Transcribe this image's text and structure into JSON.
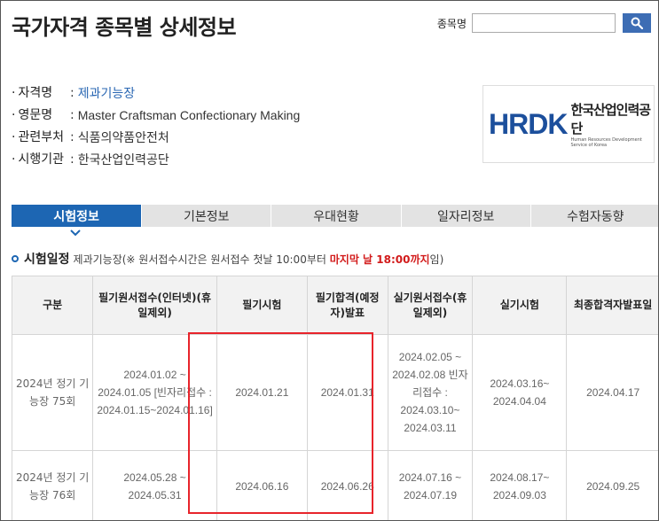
{
  "header": {
    "title": "국가자격 종목별 상세정보"
  },
  "search": {
    "label": "종목명",
    "value": "",
    "placeholder": ""
  },
  "info": [
    {
      "key": "자격명",
      "value": "제과기능장",
      "link": true
    },
    {
      "key": "영문명",
      "value": "Master Craftsman Confectionary Making",
      "link": false
    },
    {
      "key": "관련부처",
      "value": "식품의약품안전처",
      "link": false
    },
    {
      "key": "시행기관",
      "value": "한국산업인력공단",
      "link": false
    }
  ],
  "logo": {
    "mark": "HRDK",
    "name": "한국산업인력공단",
    "eng": "Human Resources Development Service of Korea"
  },
  "tabs": [
    "시험정보",
    "기본정보",
    "우대현황",
    "일자리정보",
    "수험자동향"
  ],
  "active_tab": "시험정보",
  "section": {
    "title": "시험일정",
    "note_prefix": "제과기능장(※ 원서접수시간은 원서접수 첫날 10:00부터",
    "note_warn": "마지막 날 18:00까지",
    "note_suffix": "임)"
  },
  "table": {
    "headers": [
      "구분",
      "필기원서접수(인터넷)(휴일제외)",
      "필기시험",
      "필기합격(예정자)발표",
      "실기원서접수(휴일제외)",
      "실기시험",
      "최종합격자발표일"
    ],
    "rows": [
      {
        "round": "2024년 정기 기능장 75회",
        "written_apply": "2024.01.02 ~ 2024.01.05 [빈자리접수 : 2024.01.15~2024.01.16]",
        "written_exam": "2024.01.21",
        "written_result": "2024.01.31",
        "practical_apply": "2024.02.05 ~ 2024.02.08 빈자리접수 : 2024.03.10~ 2024.03.11",
        "practical_exam": "2024.03.16~ 2024.04.04",
        "final_result": "2024.04.17"
      },
      {
        "round": "2024년 정기 기능장 76회",
        "written_apply": "2024.05.28 ~ 2024.05.31",
        "written_exam": "2024.06.16",
        "written_result": "2024.06.26",
        "practical_apply": "2024.07.16 ~ 2024.07.19",
        "practical_exam": "2024.08.17~ 2024.09.03",
        "final_result": "2024.09.25"
      }
    ]
  },
  "colors": {
    "accent": "#1d66b3",
    "warn": "#d21b1b",
    "highlight": "#e8242b"
  }
}
